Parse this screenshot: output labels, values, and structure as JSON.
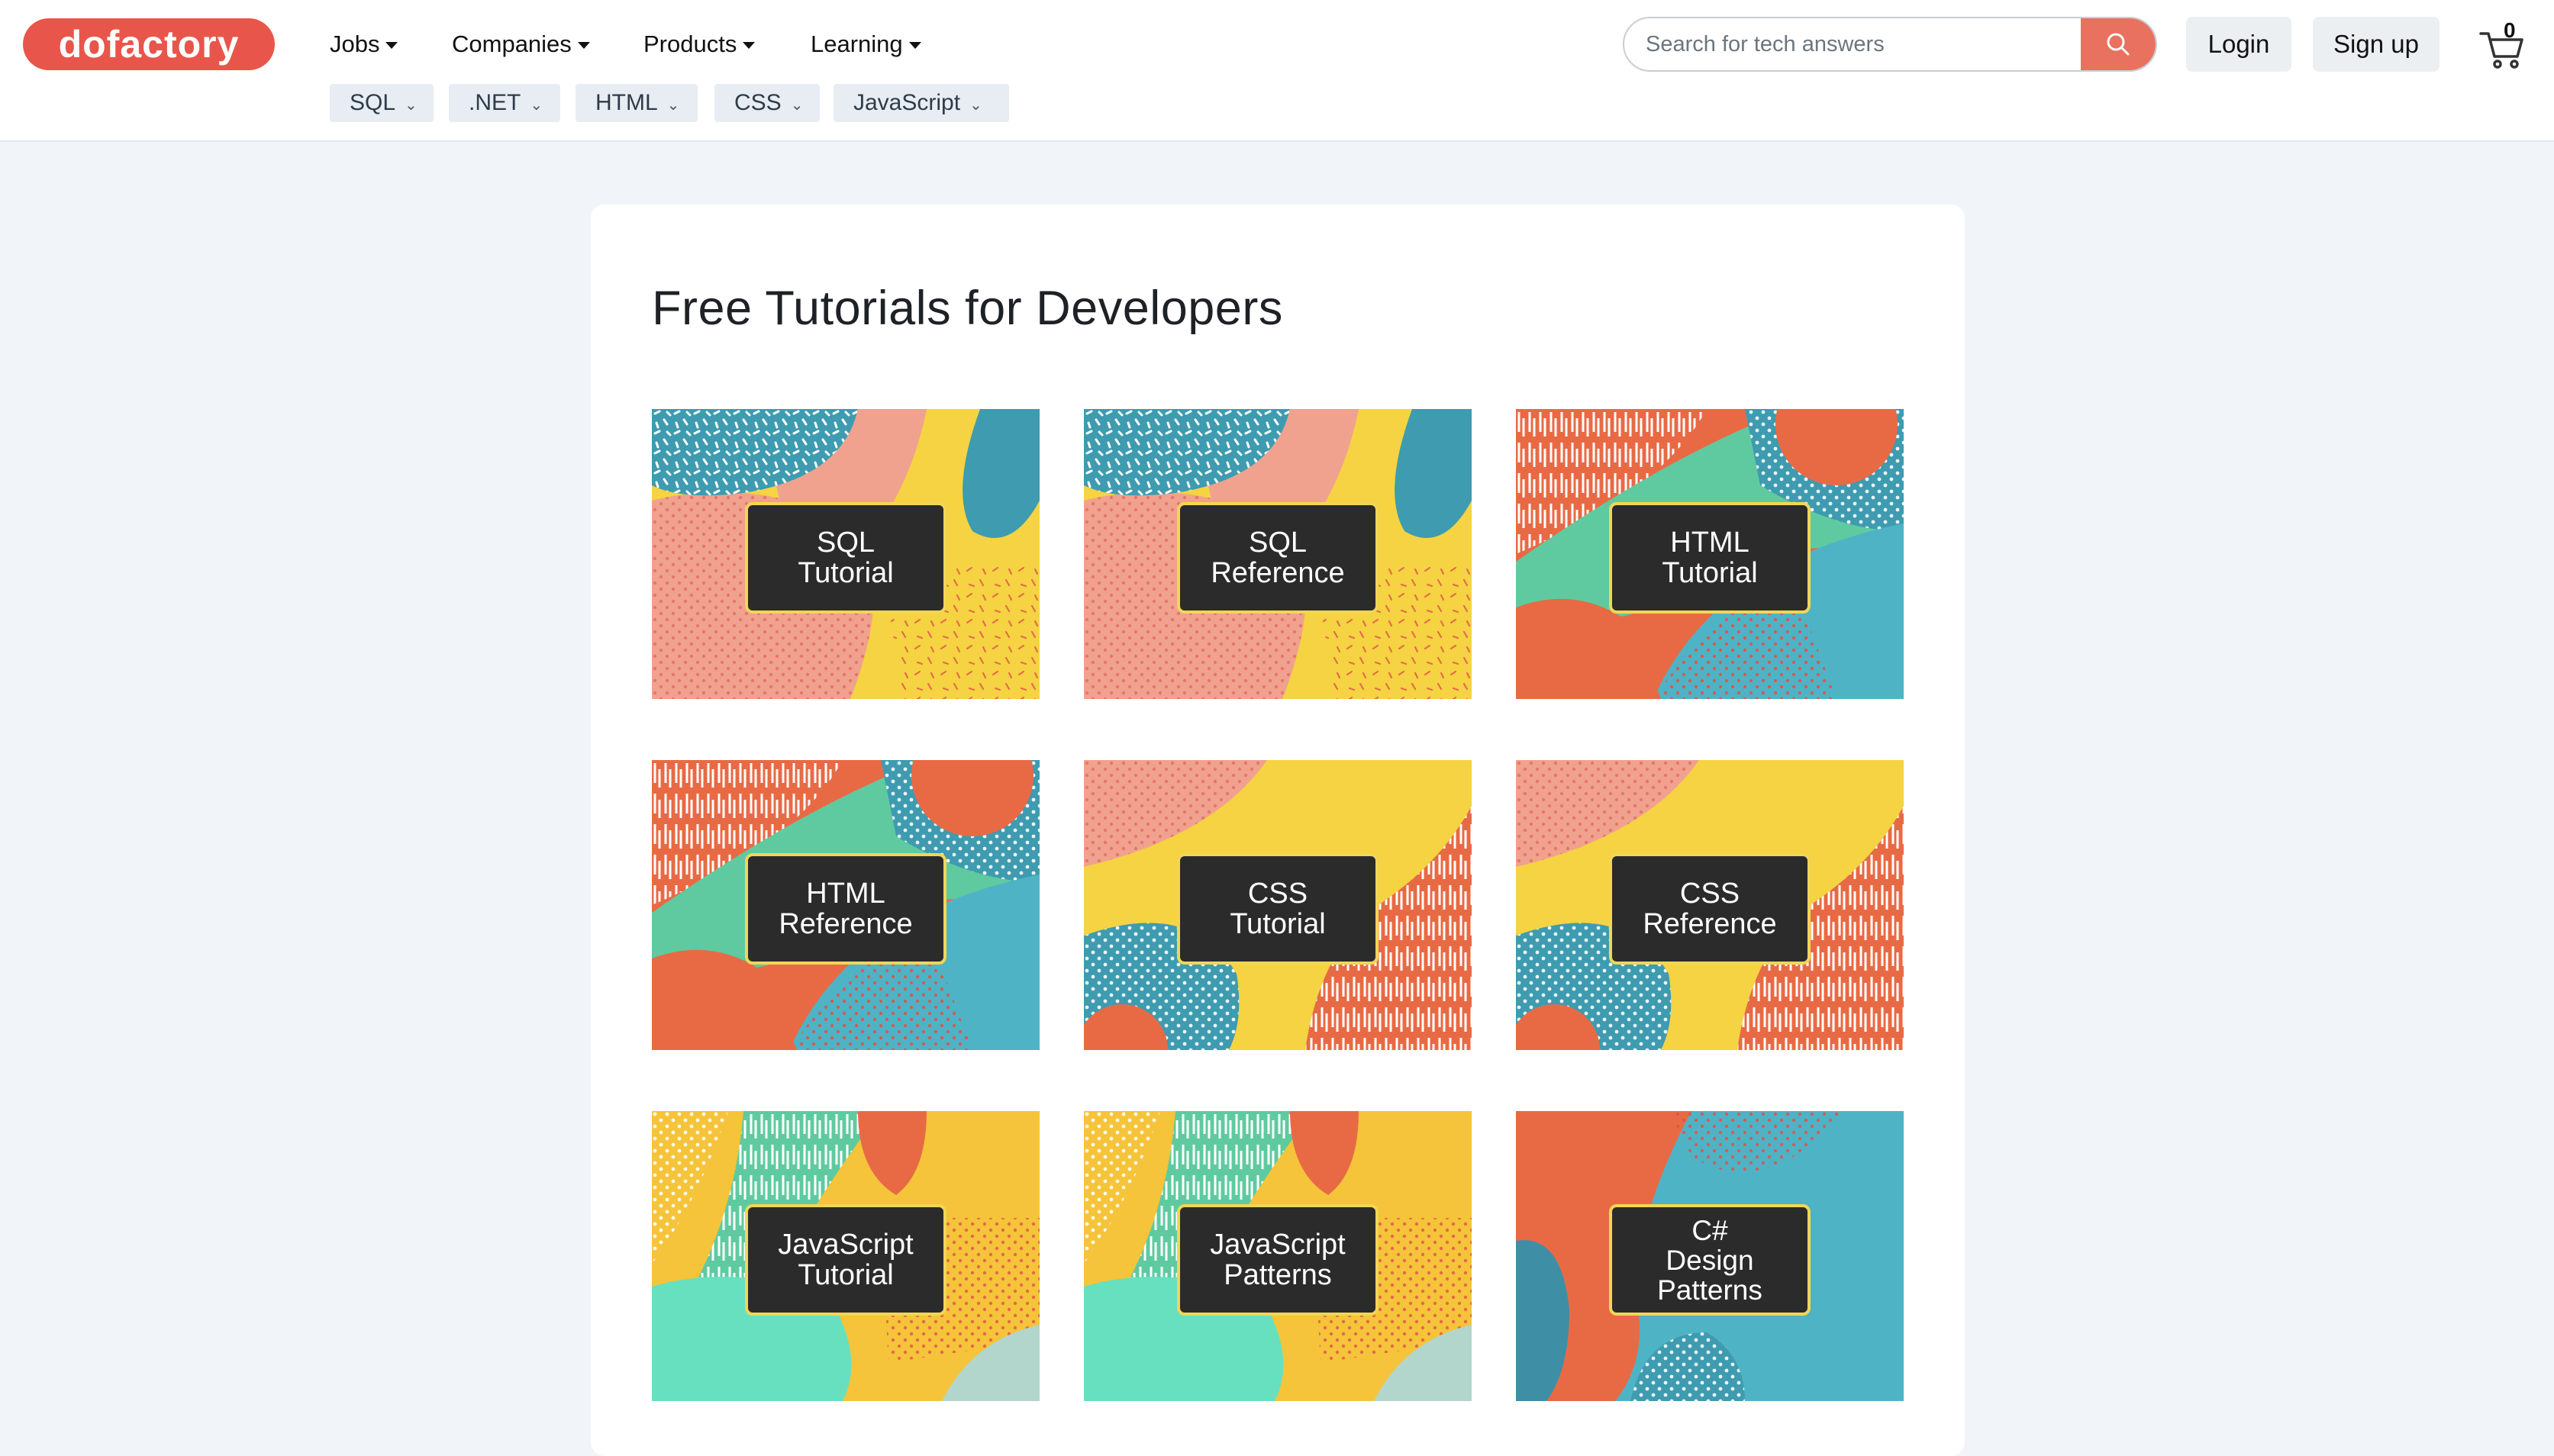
{
  "header": {
    "logo": "dofactory",
    "nav": [
      "Jobs",
      "Companies",
      "Products",
      "Learning"
    ],
    "pills": [
      "SQL",
      ".NET",
      "HTML",
      "CSS",
      "JavaScript"
    ],
    "search_placeholder": "Search for tech answers",
    "login_label": "Login",
    "signup_label": "Sign up",
    "cart_count": "0"
  },
  "colors": {
    "brand": "#e8564b",
    "search_button": "#e8725f",
    "label_border": "#f1d655",
    "label_bg": "#2b2b2b"
  },
  "main": {
    "title": "Free Tutorials for Developers",
    "tiles": [
      {
        "lines": [
          "SQL",
          "Tutorial"
        ]
      },
      {
        "lines": [
          "SQL",
          "Reference"
        ]
      },
      {
        "lines": [
          "HTML",
          "Tutorial"
        ]
      },
      {
        "lines": [
          "HTML",
          "Reference"
        ]
      },
      {
        "lines": [
          "CSS",
          "Tutorial"
        ]
      },
      {
        "lines": [
          "CSS",
          "Reference"
        ]
      },
      {
        "lines": [
          "JavaScript",
          "Tutorial"
        ]
      },
      {
        "lines": [
          "JavaScript",
          "Patterns"
        ]
      },
      {
        "lines": [
          "C#",
          "Design",
          "Patterns"
        ]
      }
    ]
  }
}
